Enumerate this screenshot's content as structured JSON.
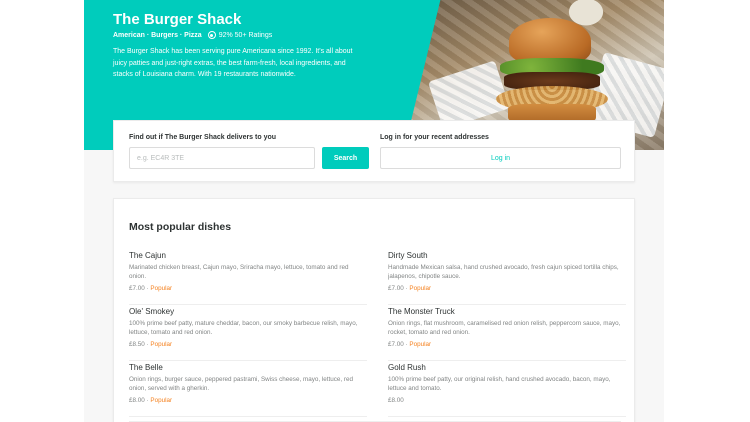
{
  "restaurant": {
    "name": "The Burger Shack",
    "cuisines": "American · Burgers · Pizza",
    "rating": "92% 50+ Ratings",
    "description": "The Burger Shack has been serving pure Americana since 1992. It's all about juicy patties and just-right extras, the best farm-fresh, local ingredients, and stacks of Louisiana charm. With 19 restaurants nationwide."
  },
  "delivery": {
    "title": "Find out if The Burger Shack delivers to you",
    "postcode_placeholder": "e.g. EC4R 3TE",
    "postcode_value": "",
    "search_label": "Search",
    "login_title": "Log in for your recent addresses",
    "login_label": "Log in"
  },
  "dishes": {
    "title": "Most popular dishes",
    "items": [
      {
        "name": "The Cajun",
        "description": "Marinated chicken breast, Cajun mayo, Sriracha mayo, lettuce, tomato and red onion.",
        "price": "£7.00",
        "separator": " · ",
        "badge": "Popular"
      },
      {
        "name": "Dirty South",
        "description": "Handmade Mexican salsa, hand crushed avocado, fresh cajun spiced tortilla chips, jalapenos, chipotle sauce.",
        "price": "£7.00",
        "separator": " · ",
        "badge": "Popular"
      },
      {
        "name": "Ole' Smokey",
        "description": "100% prime beef patty, mature cheddar, bacon, our smoky barbecue relish, mayo, lettuce, tomato and red onion.",
        "price": "£8.50",
        "separator": " · ",
        "badge": "Popular"
      },
      {
        "name": "The Monster Truck",
        "description": "Onion rings, flat mushroom, caramelised red onion relish, peppercorn sauce, mayo, rocket, tomato and red onion.",
        "price": "£7.00",
        "separator": " · ",
        "badge": "Popular"
      },
      {
        "name": "The Belle",
        "description": "Onion rings, burger sauce, peppered pastrami, Swiss cheese, mayo, lettuce, red onion, served with a gherkin.",
        "price": "£8.00",
        "separator": " · ",
        "badge": "Popular"
      },
      {
        "name": "Gold Rush",
        "description": "100% prime beef patty, our original relish, hand crushed avocado, bacon, mayo, lettuce and tomato.",
        "price": "£8.00",
        "separator": "",
        "badge": ""
      }
    ]
  },
  "colors": {
    "brand": "#00ccbc",
    "popular": "#f58220",
    "text": "#2e3333",
    "muted": "#828585"
  },
  "icons": {
    "rating": "rating-icon"
  }
}
